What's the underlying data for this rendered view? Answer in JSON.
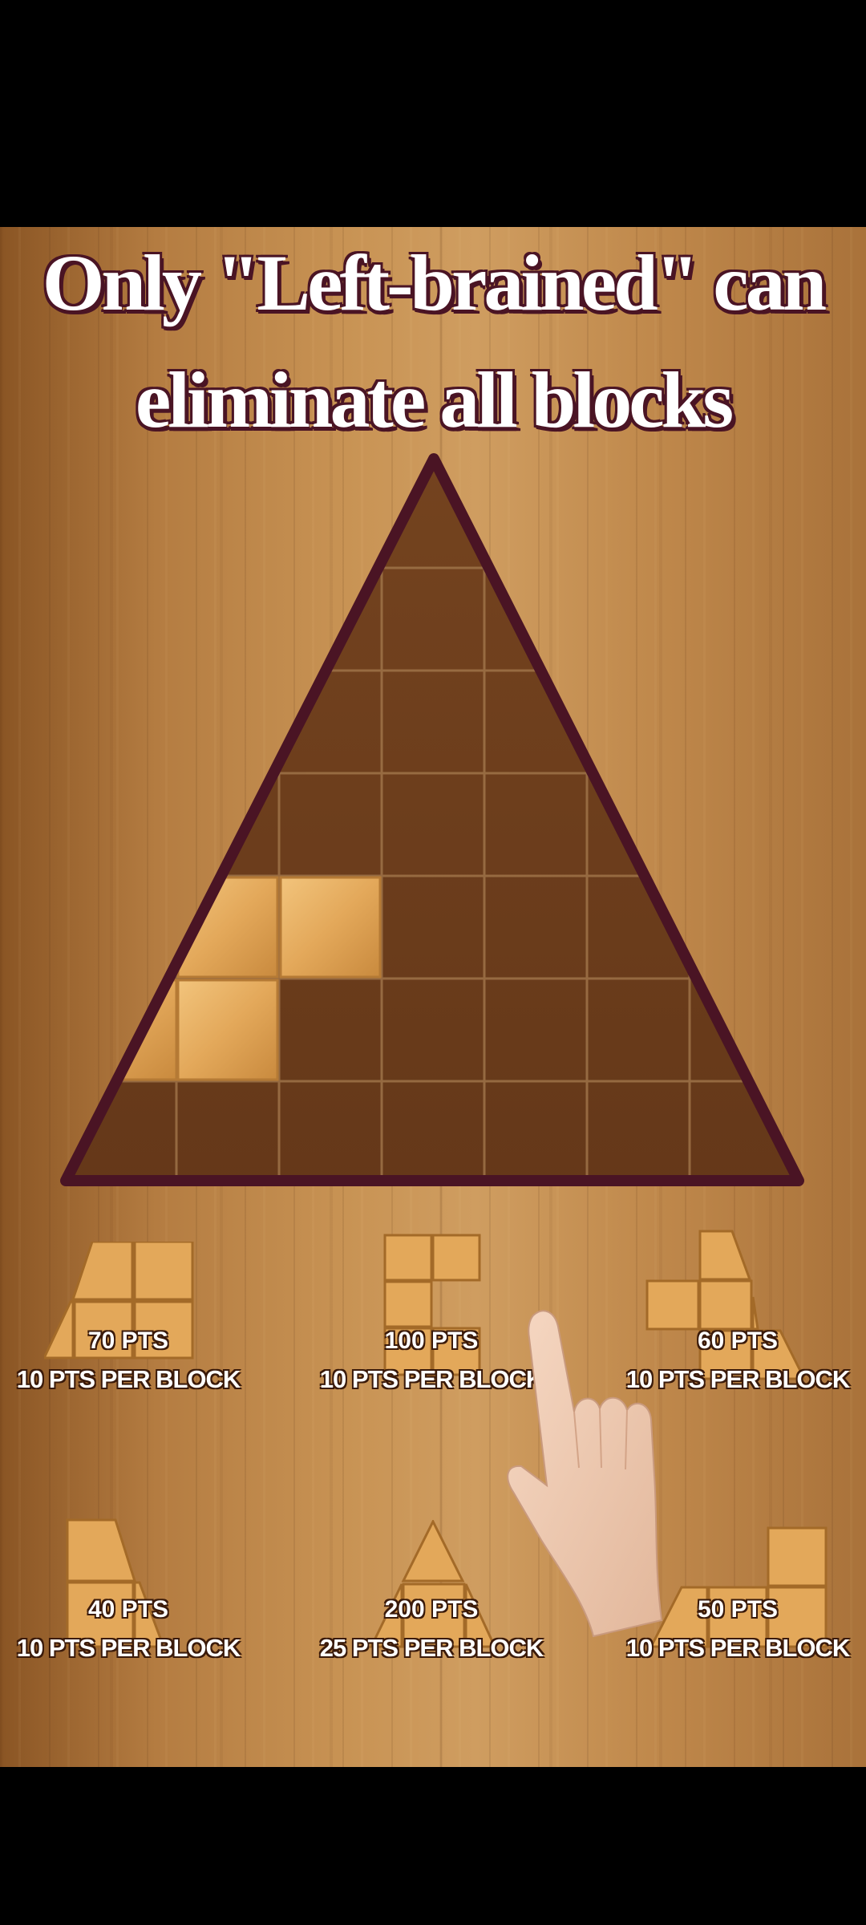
{
  "headline": {
    "line1": "Only \"Left-brained\" can",
    "line2": "eliminate all blocks"
  },
  "pieces": [
    {
      "points": "70 PTS",
      "per_block": "10 PTS PER BLOCK"
    },
    {
      "points": "100 PTS",
      "per_block": "10 PTS PER BLOCK"
    },
    {
      "points": "60 PTS",
      "per_block": "10 PTS PER BLOCK"
    },
    {
      "points": "40 PTS",
      "per_block": "10 PTS PER BLOCK"
    },
    {
      "points": "200 PTS",
      "per_block": "25 PTS PER BLOCK"
    },
    {
      "points": "50 PTS",
      "per_block": "10 PTS PER BLOCK"
    }
  ],
  "colors": {
    "board_outline": "#4a1424",
    "board_cell": "#6e3e1f",
    "filled_block": "#e3a85a",
    "text_outline": "#4a1424"
  }
}
